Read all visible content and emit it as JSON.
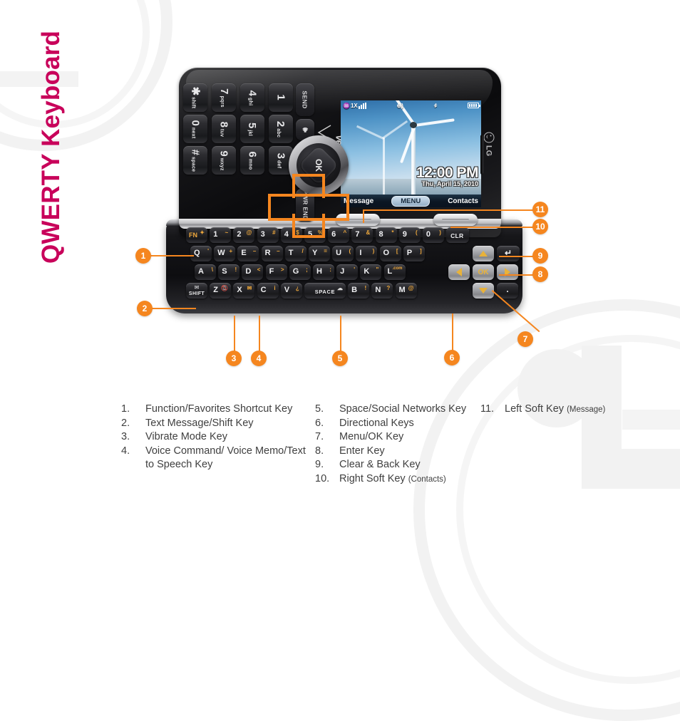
{
  "page": {
    "title_part1": "QWERTY",
    "title_part2": "Keyboard"
  },
  "phone": {
    "brand_carrier": "verizon",
    "brand_maker": "LG",
    "screen": {
      "status": {
        "network_label": "1X",
        "antenna_icon": "antenna-icon",
        "signal_bars": 4,
        "location_icon": "location-icon",
        "bluetooth_icon": "bluetooth-icon",
        "battery_icon": "battery-icon",
        "battery_bars": 4
      },
      "clock": "12:00 PM",
      "date": "Thu, April 15, 2010",
      "softkeys": {
        "left": "Message",
        "center": "MENU",
        "right": "Contacts"
      },
      "wallpaper": "wind-turbine-photo"
    },
    "numpad": {
      "keys": [
        {
          "main": "1",
          "sub": ""
        },
        {
          "main": "2",
          "sub": "abc"
        },
        {
          "main": "3",
          "sub": "def"
        },
        {
          "main": "4",
          "sub": "ghi"
        },
        {
          "main": "5",
          "sub": "jkl"
        },
        {
          "main": "6",
          "sub": "mno"
        },
        {
          "main": "7",
          "sub": "pqrs"
        },
        {
          "main": "8",
          "sub": "tuv"
        },
        {
          "main": "9",
          "sub": "wxyz"
        },
        {
          "main": "✱",
          "sub": "shift"
        },
        {
          "main": "0",
          "sub": "next"
        },
        {
          "main": "#",
          "sub": "space"
        }
      ],
      "send_label": "SEND",
      "speaker_label": "speaker-icon",
      "end_label": "PWR END",
      "clr_label": "CLR",
      "ok_label": "OK"
    },
    "qwerty": {
      "row1": [
        {
          "main": "FN",
          "alt": "✦"
        },
        {
          "main": "1",
          "alt": "~"
        },
        {
          "main": "2",
          "alt": "@"
        },
        {
          "main": "3",
          "alt": "#"
        },
        {
          "main": "4",
          "alt": "$"
        },
        {
          "main": "5",
          "alt": "%"
        },
        {
          "main": "6",
          "alt": "^"
        },
        {
          "main": "7",
          "alt": "&"
        },
        {
          "main": "8",
          "alt": "*"
        },
        {
          "main": "9",
          "alt": "("
        },
        {
          "main": "0",
          "alt": ")"
        },
        {
          "main": "CLR",
          "alt": ""
        }
      ],
      "row2": [
        {
          "main": "Q",
          "alt": "'"
        },
        {
          "main": "W",
          "alt": "+"
        },
        {
          "main": "E",
          "alt": "–"
        },
        {
          "main": "R",
          "alt": "–"
        },
        {
          "main": "T",
          "alt": "/"
        },
        {
          "main": "Y",
          "alt": "="
        },
        {
          "main": "U",
          "alt": "("
        },
        {
          "main": "I",
          "alt": ")"
        },
        {
          "main": "O",
          "alt": "["
        },
        {
          "main": "P",
          "alt": "]"
        }
      ],
      "row3": [
        {
          "main": "A",
          "alt": "\\"
        },
        {
          "main": "S",
          "alt": "!"
        },
        {
          "main": "D",
          "alt": "<"
        },
        {
          "main": "F",
          "alt": ">"
        },
        {
          "main": "G",
          "alt": ";"
        },
        {
          "main": "H",
          "alt": ":"
        },
        {
          "main": "J",
          "alt": "'"
        },
        {
          "main": "K",
          "alt": "\""
        },
        {
          "main": "L",
          "alt": ".com"
        }
      ],
      "row4": [
        {
          "main": "SHIFT",
          "alt": ""
        },
        {
          "main": "Z",
          "alt": ""
        },
        {
          "main": "X",
          "alt": ""
        },
        {
          "main": "C",
          "alt": "i"
        },
        {
          "main": "V",
          "alt": "¿"
        },
        {
          "main": "SPACE",
          "alt": ""
        },
        {
          "main": "B",
          "alt": "!"
        },
        {
          "main": "N",
          "alt": "?"
        },
        {
          "main": "M",
          "alt": "@"
        },
        {
          "main": ".",
          "alt": ""
        }
      ],
      "enter_label": "↵",
      "nav": {
        "up": "up-arrow",
        "down": "down-arrow",
        "left": "left-arrow",
        "right": "right-arrow",
        "ok": "OK"
      }
    }
  },
  "callouts": [
    {
      "num": "1"
    },
    {
      "num": "2"
    },
    {
      "num": "3"
    },
    {
      "num": "4"
    },
    {
      "num": "5"
    },
    {
      "num": "6"
    },
    {
      "num": "7"
    },
    {
      "num": "8"
    },
    {
      "num": "9"
    },
    {
      "num": "10"
    },
    {
      "num": "11"
    }
  ],
  "legend": {
    "column1": [
      {
        "num": "1.",
        "text": "Function/Favorites Shortcut Key",
        "note": ""
      },
      {
        "num": "2.",
        "text": "Text Message/Shift Key",
        "note": ""
      },
      {
        "num": "3.",
        "text": "Vibrate Mode Key",
        "note": ""
      },
      {
        "num": "4.",
        "text": "Voice Command/ Voice Memo/Text to Speech Key",
        "note": ""
      }
    ],
    "column2": [
      {
        "num": "5.",
        "text": "Space/Social Networks Key",
        "note": ""
      },
      {
        "num": "6.",
        "text": "Directional Keys",
        "note": ""
      },
      {
        "num": "7.",
        "text": "Menu/OK Key",
        "note": ""
      },
      {
        "num": "8.",
        "text": "Enter Key",
        "note": ""
      },
      {
        "num": "9.",
        "text": "Clear & Back Key",
        "note": ""
      },
      {
        "num": "10.",
        "text": "Right Soft Key ",
        "note": "(Contacts)"
      }
    ],
    "column3": [
      {
        "num": "11.",
        "text": "Left Soft Key ",
        "note": "(Message)"
      }
    ]
  },
  "colors": {
    "accent_orange": "#F5861F",
    "title_crimson": "#C8005A",
    "legend_text": "#3F3F3F"
  }
}
